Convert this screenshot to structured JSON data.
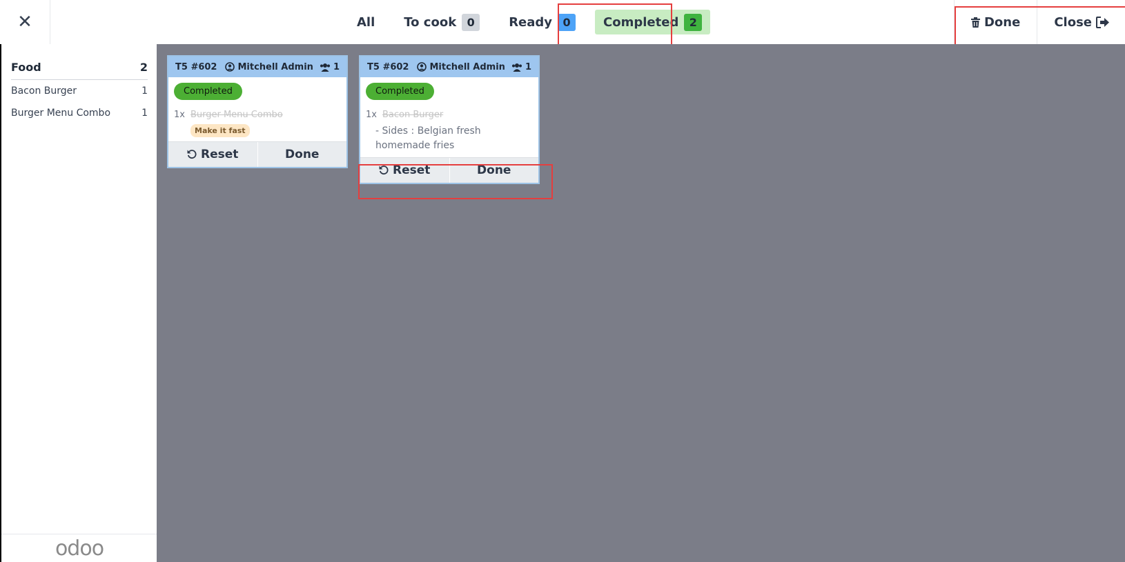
{
  "header": {
    "close_icon": "close-icon",
    "tabs": [
      {
        "label": "All"
      },
      {
        "label": "To cook",
        "count": "0",
        "color": "#d1d5db"
      },
      {
        "label": "Ready",
        "count": "0",
        "color": "#4da3f7"
      },
      {
        "label": "Completed",
        "count": "2",
        "color": "#3fb33f"
      }
    ],
    "active_tab": "Completed",
    "actions": {
      "done_label": "Done",
      "close_label": "Close"
    }
  },
  "sidebar": {
    "category": {
      "label": "Food",
      "count": "2"
    },
    "items": [
      {
        "label": "Bacon Burger",
        "count": "1"
      },
      {
        "label": "Burger Menu Combo",
        "count": "1"
      }
    ],
    "logo": "odoo"
  },
  "orders": [
    {
      "ref": "T5 #602",
      "user": "Mitchell Admin",
      "guests": "1",
      "status": "Completed",
      "lines": [
        {
          "qty": "1x",
          "product": "Burger Menu Combo",
          "note": "Make it fast"
        }
      ],
      "reset_label": "Reset",
      "done_label": "Done"
    },
    {
      "ref": "T5 #602",
      "user": "Mitchell Admin",
      "guests": "1",
      "status": "Completed",
      "lines": [
        {
          "qty": "1x",
          "product": "Bacon Burger",
          "attribute": "- Sides : Belgian fresh homemade fries"
        }
      ],
      "reset_label": "Reset",
      "done_label": "Done"
    }
  ],
  "colors": {
    "accent_status": "#4caf34",
    "card_header": "#9ec6ef",
    "background": "#7b7d88",
    "highlight": "#e53e3e"
  }
}
